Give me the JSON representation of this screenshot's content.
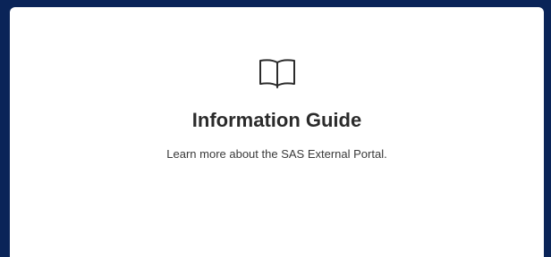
{
  "card": {
    "icon": "open-book-icon",
    "title": "Information Guide",
    "description": "Learn more about the SAS External Portal."
  },
  "colors": {
    "background": "#0a2458",
    "card": "#ffffff",
    "title": "#2b2b2b",
    "text": "#3a3a3a"
  }
}
